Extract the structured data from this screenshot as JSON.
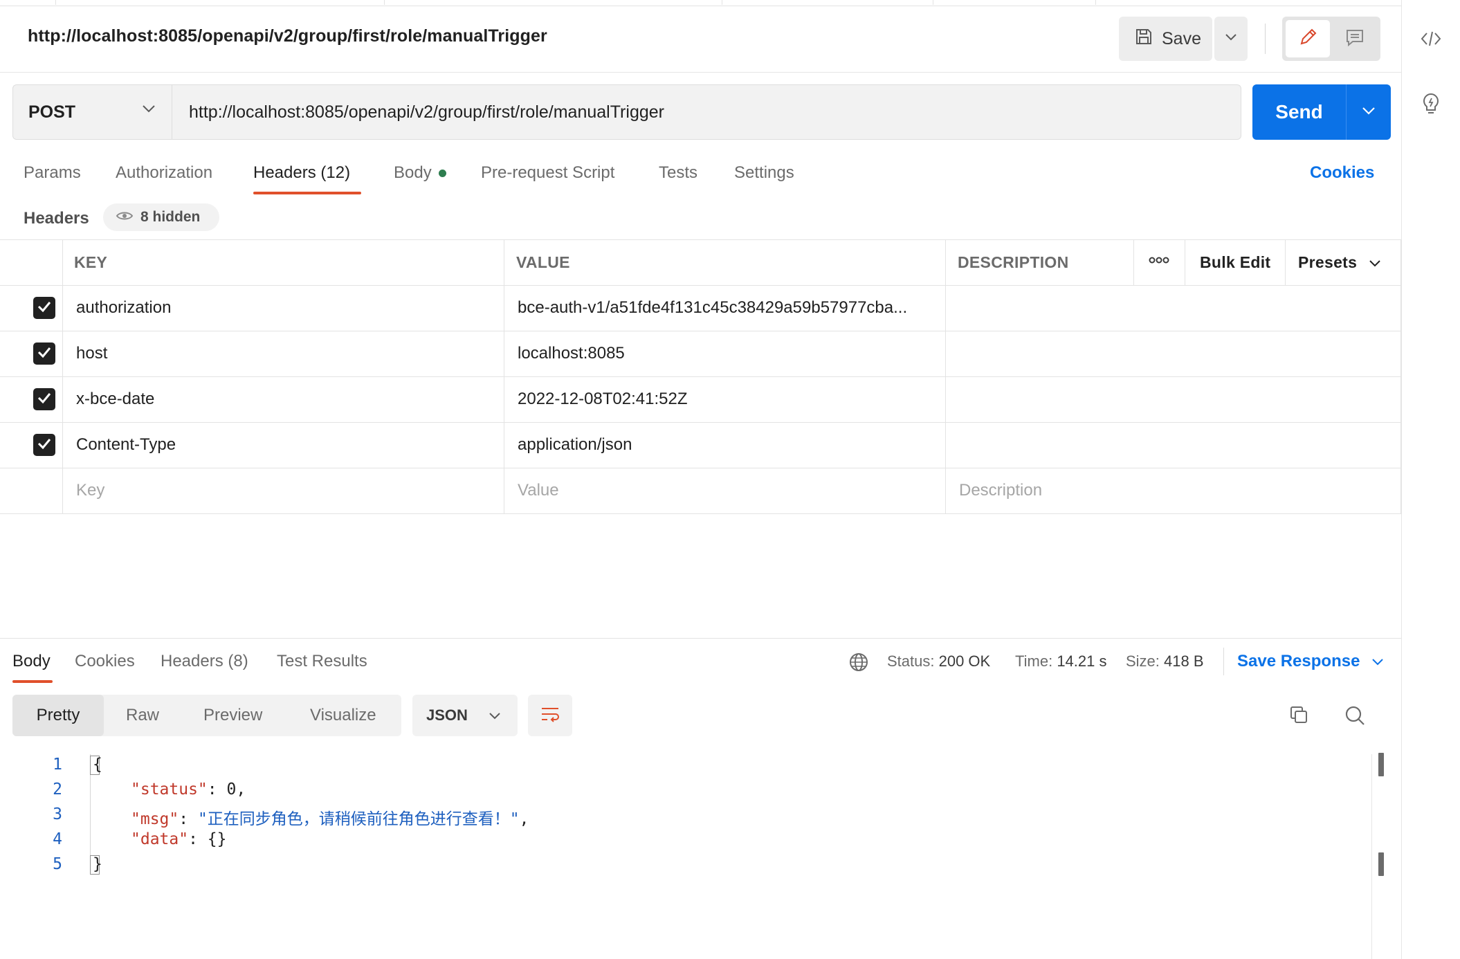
{
  "request": {
    "title": "http://localhost:8085/openapi/v2/group/first/role/manualTrigger",
    "save_label": "Save",
    "method": "POST",
    "url": "http://localhost:8085/openapi/v2/group/first/role/manualTrigger",
    "send_label": "Send"
  },
  "request_tabs": [
    {
      "label": "Params"
    },
    {
      "label": "Authorization"
    },
    {
      "label": "Headers (12)",
      "active": true
    },
    {
      "label": "Body"
    },
    {
      "label": "Pre-request Script"
    },
    {
      "label": "Tests"
    },
    {
      "label": "Settings"
    }
  ],
  "cookies_label": "Cookies",
  "headers_section": {
    "label": "Headers",
    "hidden_label": "8 hidden",
    "columns": {
      "key": "KEY",
      "value": "VALUE",
      "description": "DESCRIPTION"
    },
    "bulk_edit_label": "Bulk Edit",
    "presets_label": "Presets",
    "rows": [
      {
        "key": "authorization",
        "value": "bce-auth-v1/a51fde4f131c45c38429a59b57977cba...",
        "checked": true
      },
      {
        "key": "host",
        "value": "localhost:8085",
        "checked": true
      },
      {
        "key": "x-bce-date",
        "value": "2022-12-08T02:41:52Z",
        "checked": true
      },
      {
        "key": "Content-Type",
        "value": "application/json",
        "checked": true
      }
    ],
    "placeholders": {
      "key": "Key",
      "value": "Value",
      "description": "Description"
    }
  },
  "response": {
    "tabs": [
      {
        "label": "Body",
        "active": true
      },
      {
        "label": "Cookies"
      },
      {
        "label": "Headers (8)"
      },
      {
        "label": "Test Results"
      }
    ],
    "status_label": "Status:",
    "status_value": "200 OK",
    "time_label": "Time:",
    "time_value": "14.21 s",
    "size_label": "Size:",
    "size_value": "418 B",
    "save_response_label": "Save Response",
    "formats": [
      "Pretty",
      "Raw",
      "Preview",
      "Visualize"
    ],
    "format_type": "JSON",
    "code_lines": [
      {
        "n": "1",
        "text": "{"
      },
      {
        "n": "2",
        "key": "\"status\"",
        "rest": ": 0,"
      },
      {
        "n": "3",
        "key": "\"msg\"",
        "sep": ": ",
        "str": "\"正在同步角色，请稍候前往角色进行查看！\"",
        "tail": ","
      },
      {
        "n": "4",
        "key": "\"data\"",
        "rest": ": {}"
      },
      {
        "n": "5",
        "text": "}"
      }
    ]
  },
  "colors": {
    "accent": "#0b72e7",
    "tab_underline": "#e0502b",
    "json_key": "#c0392b",
    "json_string": "#1d5fbf"
  },
  "icons": [
    "save-icon",
    "chevron-down-icon",
    "pencil-icon",
    "comment-icon",
    "code-icon",
    "lightbulb-icon",
    "eye-icon",
    "more-horizontal-icon",
    "globe-icon",
    "wrap-lines-icon",
    "copy-icon",
    "search-icon",
    "checkbox-checked-icon"
  ]
}
